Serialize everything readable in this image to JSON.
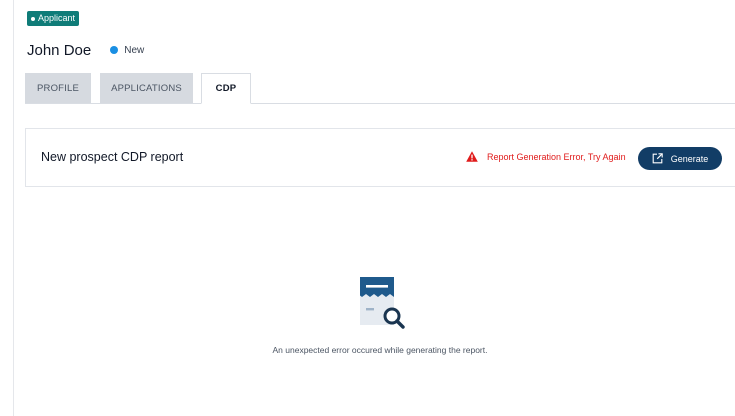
{
  "header": {
    "badge_label": "Applicant",
    "name": "John Doe",
    "status_label": "New"
  },
  "tabs": [
    {
      "label": "PROFILE",
      "active": false
    },
    {
      "label": "APPLICATIONS",
      "active": false
    },
    {
      "label": "CDP",
      "active": true
    }
  ],
  "report": {
    "title": "New prospect CDP report",
    "error_text": "Report Generation Error, Try Again",
    "generate_label": "Generate"
  },
  "empty_state": {
    "message": "An unexpected error occured while generating the report."
  },
  "colors": {
    "badge": "#0f7c78",
    "status_dot": "#1a8fe3",
    "error": "#e01b1b",
    "primary_button": "#123d66",
    "illustration_blue": "#1f5a8c",
    "illustration_light": "#e6ebf1"
  },
  "icons": {
    "badge_dot": "dot-icon",
    "status_dot": "status-dot-icon",
    "error": "warning-triangle-icon",
    "generate": "external-link-icon",
    "empty": "receipt-search-icon"
  }
}
